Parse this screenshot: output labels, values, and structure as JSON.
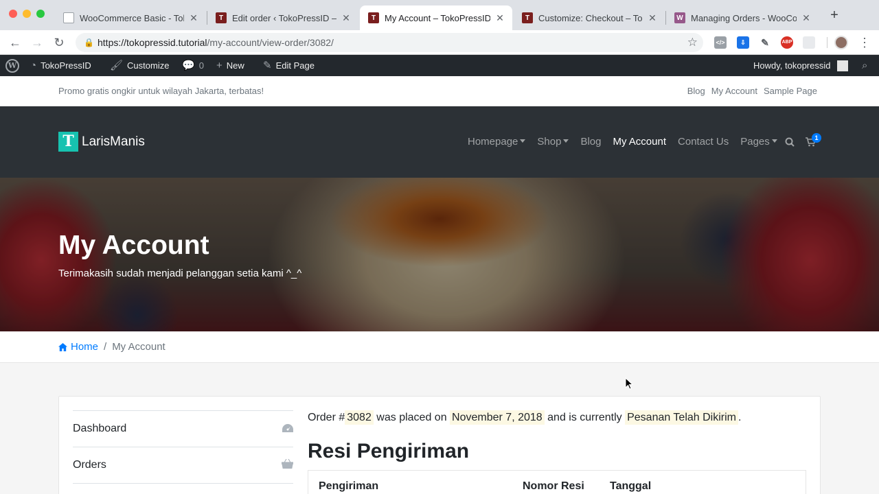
{
  "browser": {
    "tabs": [
      {
        "title": "WooCommerce Basic - Toko",
        "active": false
      },
      {
        "title": "Edit order ‹ TokoPressID —",
        "active": false
      },
      {
        "title": "My Account – TokoPressID",
        "active": true
      },
      {
        "title": "Customize: Checkout – Toko",
        "active": false
      },
      {
        "title": "Managing Orders - WooCom",
        "active": false
      }
    ],
    "url_host": "https://tokopressid.tutorial",
    "url_path": "/my-account/view-order/3082/"
  },
  "adminbar": {
    "site_name": "TokoPressID",
    "customize": "Customize",
    "comments_count": "0",
    "new": "New",
    "edit_page": "Edit Page",
    "howdy": "Howdy, tokopressid"
  },
  "topbar": {
    "promo": "Promo gratis ongkir untuk wilayah Jakarta, terbatas!",
    "links": [
      "Blog",
      "My Account",
      "Sample Page"
    ]
  },
  "header": {
    "brand": "LarisManis",
    "nav": [
      {
        "label": "Homepage",
        "dropdown": true,
        "active": false
      },
      {
        "label": "Shop",
        "dropdown": true,
        "active": false
      },
      {
        "label": "Blog",
        "dropdown": false,
        "active": false
      },
      {
        "label": "My Account",
        "dropdown": false,
        "active": true
      },
      {
        "label": "Contact Us",
        "dropdown": false,
        "active": false
      },
      {
        "label": "Pages",
        "dropdown": true,
        "active": false
      }
    ],
    "cart_count": "1"
  },
  "hero": {
    "title": "My Account",
    "subtitle": "Terimakasih sudah menjadi pelanggan setia kami ^_^"
  },
  "breadcrumb": {
    "home": "Home",
    "current": "My Account"
  },
  "account_nav": [
    {
      "label": "Dashboard",
      "icon": "dashboard-icon"
    },
    {
      "label": "Orders",
      "icon": "basket-icon"
    }
  ],
  "order": {
    "prefix": "Order #",
    "number": "3082",
    "placed_text": "was placed on",
    "date": "November 7, 2018",
    "status_text": "and is currently",
    "status": "Pesanan Telah Dikirim",
    "suffix": "."
  },
  "resi": {
    "title": "Resi Pengiriman",
    "columns": [
      "Pengiriman",
      "Nomor Resi",
      "Tanggal"
    ]
  }
}
